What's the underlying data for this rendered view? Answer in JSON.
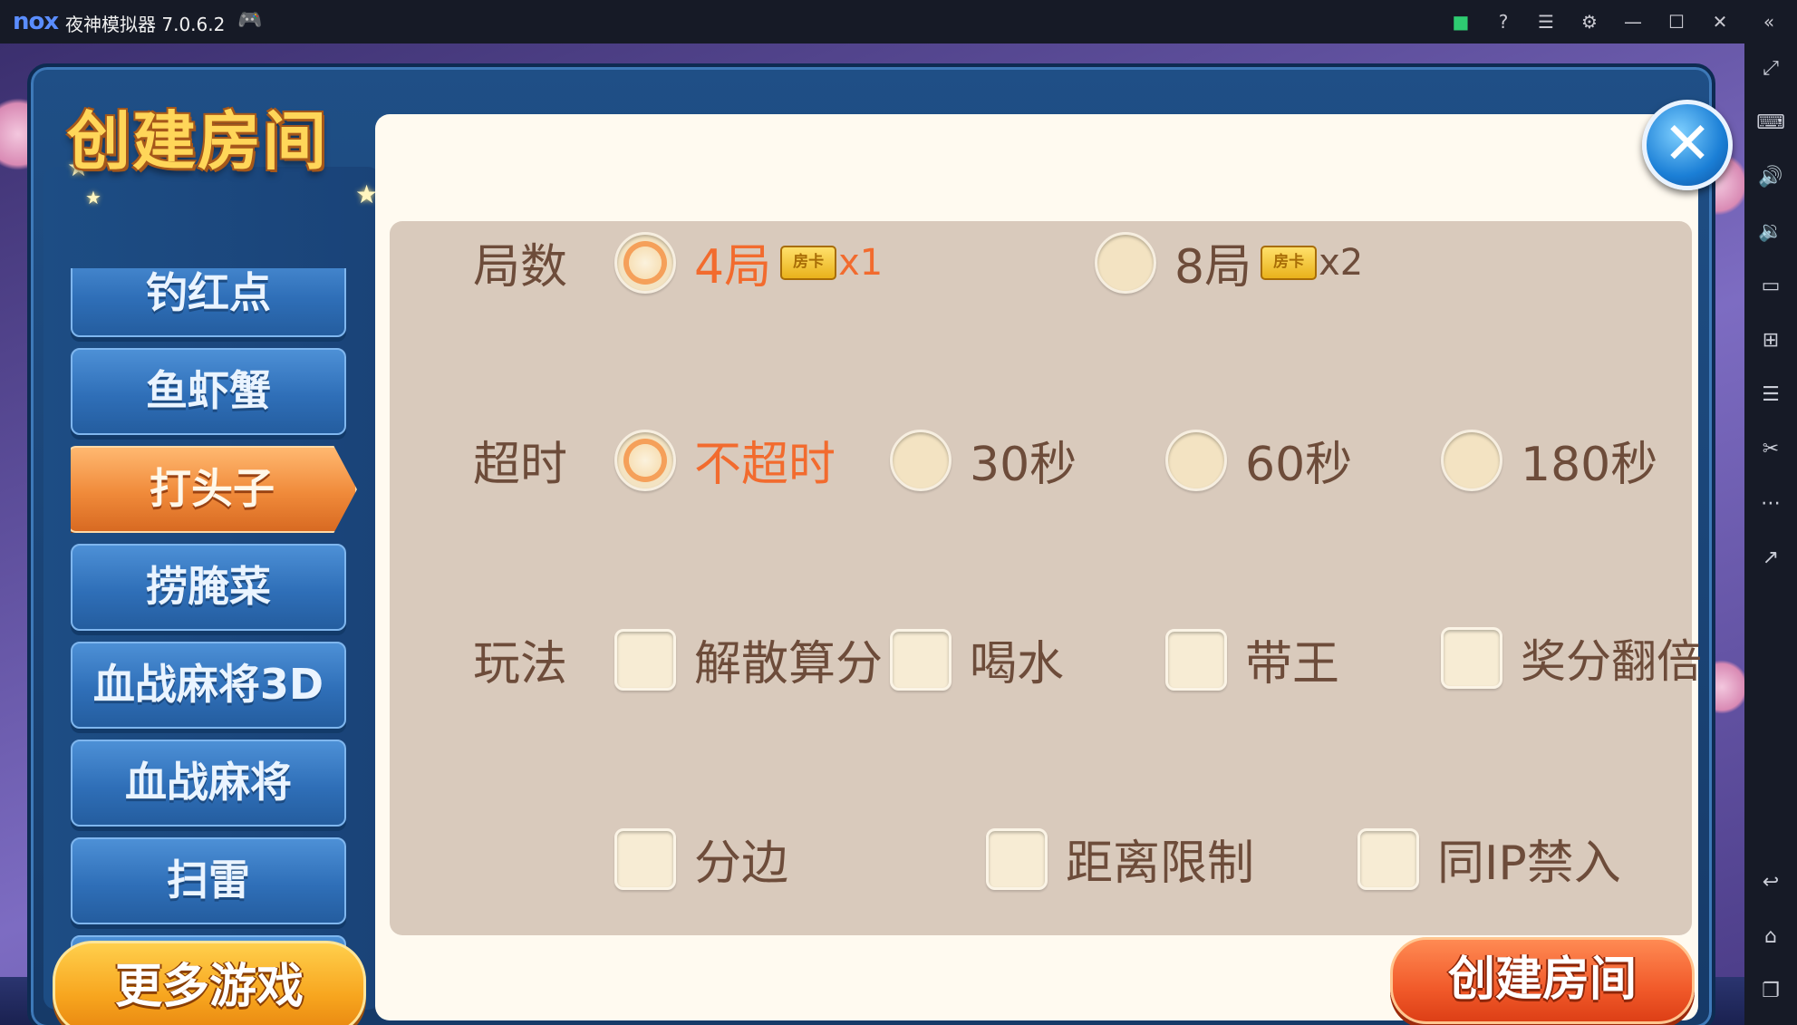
{
  "emulator": {
    "logo": "nox",
    "title": "夜神模拟器 7.0.6.2",
    "titlebar_icons": [
      "gamepad-icon",
      "store-icon",
      "help-icon",
      "menu-icon",
      "settings-icon",
      "minimize-icon",
      "maximize-icon",
      "close-icon",
      "collapse-icon"
    ],
    "sidebar_icons": [
      "fullscreen-icon",
      "keyboard-icon",
      "volume-up-icon",
      "volume-down-icon",
      "screen-icon",
      "apk-install-icon",
      "multi-instance-icon",
      "screenshot-icon",
      "more-icon",
      "share-icon",
      "back-icon",
      "home-icon",
      "recent-apps-icon"
    ]
  },
  "dialog": {
    "title": "创建房间",
    "games": [
      {
        "label": "钓红点",
        "active": false
      },
      {
        "label": "鱼虾蟹",
        "active": false
      },
      {
        "label": "打头子",
        "active": true
      },
      {
        "label": "捞腌菜",
        "active": false
      },
      {
        "label": "血战麻将3D",
        "active": false
      },
      {
        "label": "血战麻将",
        "active": false
      },
      {
        "label": "扫雷",
        "active": false
      }
    ],
    "more_games_label": "更多游戏",
    "create_button_label": "创建房间",
    "rows": {
      "rounds": {
        "label": "局数",
        "options": [
          {
            "label": "4局",
            "card": "房卡",
            "mult": "x1",
            "selected": true
          },
          {
            "label": "8局",
            "card": "房卡",
            "mult": "x2",
            "selected": false
          }
        ]
      },
      "timeout": {
        "label": "超时",
        "options": [
          {
            "label": "不超时",
            "selected": true
          },
          {
            "label": "30秒",
            "selected": false
          },
          {
            "label": "60秒",
            "selected": false
          },
          {
            "label": "180秒",
            "selected": false
          }
        ]
      },
      "rules": {
        "label": "玩法",
        "options": [
          {
            "label": "解散算分",
            "checked": false
          },
          {
            "label": "喝水",
            "checked": false
          },
          {
            "label": "带王",
            "checked": false
          },
          {
            "label": "奖分翻倍",
            "checked": false
          }
        ]
      },
      "extra": {
        "options": [
          {
            "label": "分边",
            "checked": false
          },
          {
            "label": "距离限制",
            "checked": false
          },
          {
            "label": "同IP禁入",
            "checked": false
          }
        ]
      }
    }
  },
  "colors": {
    "selected_text": "#f26b2e",
    "normal_text": "#6d4c3a",
    "panel_bg": "#d9cabc",
    "menu_blue": "#2f6fb8",
    "menu_active_orange": "#f08a3a"
  }
}
